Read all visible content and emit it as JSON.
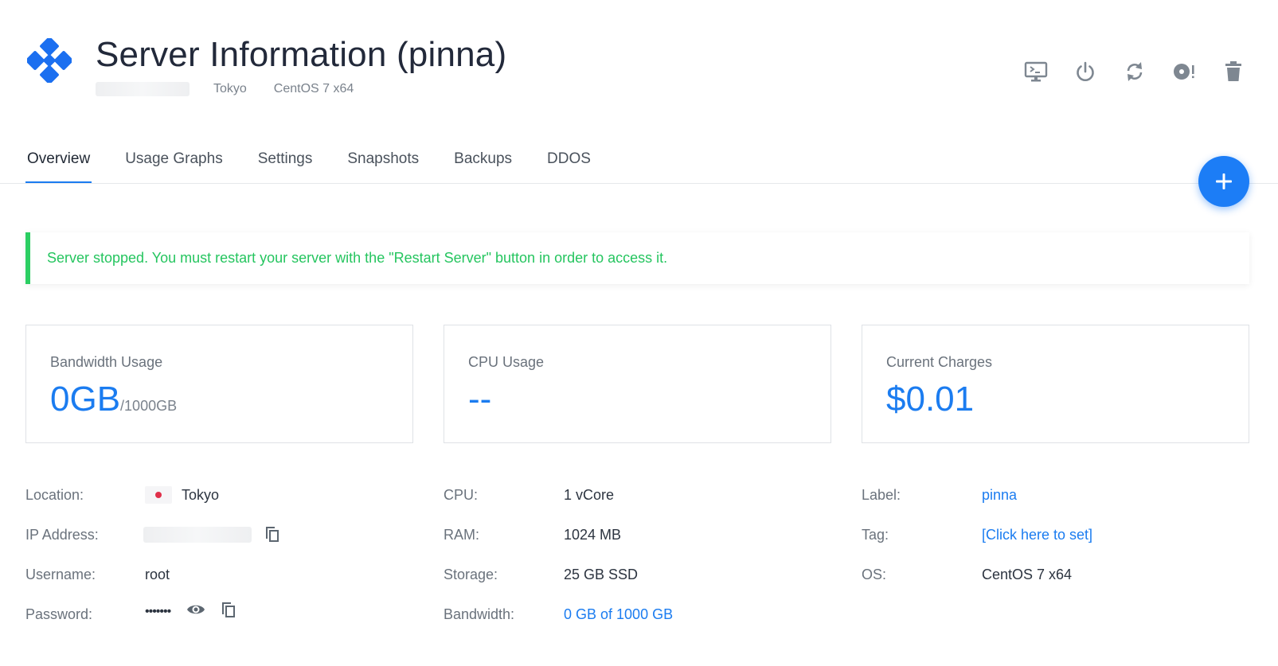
{
  "header": {
    "title": "Server Information (pinna)",
    "location": "Tokyo",
    "os": "CentOS 7 x64",
    "logo_icon": "vultr-logo-icon",
    "accent_color": "#1b7cf0"
  },
  "toolbar": {
    "buttons": [
      {
        "name": "console-icon"
      },
      {
        "name": "power-icon"
      },
      {
        "name": "restart-icon"
      },
      {
        "name": "reinstall-icon"
      },
      {
        "name": "trash-icon"
      }
    ]
  },
  "tabs": [
    {
      "label": "Overview",
      "active": true
    },
    {
      "label": "Usage Graphs",
      "active": false
    },
    {
      "label": "Settings",
      "active": false
    },
    {
      "label": "Snapshots",
      "active": false
    },
    {
      "label": "Backups",
      "active": false
    },
    {
      "label": "DDOS",
      "active": false
    }
  ],
  "fab": {
    "icon": "plus-icon"
  },
  "alert": {
    "message": "Server stopped. You must restart your server with the \"Restart Server\" button in order to access it.",
    "color": "#25c55f"
  },
  "cards": [
    {
      "label": "Bandwidth Usage",
      "value": "0GB",
      "suffix": "/1000GB"
    },
    {
      "label": "CPU Usage",
      "value": "--",
      "suffix": ""
    },
    {
      "label": "Current Charges",
      "value": "$0.01",
      "suffix": ""
    }
  ],
  "details": {
    "location_label": "Location:",
    "location_value": "Tokyo",
    "ip_label": "IP Address:",
    "username_label": "Username:",
    "username_value": "root",
    "password_label": "Password:",
    "password_value": "•••••••",
    "cpu_label": "CPU:",
    "cpu_value": "1 vCore",
    "ram_label": "RAM:",
    "ram_value": "1024 MB",
    "storage_label": "Storage:",
    "storage_value": "25 GB SSD",
    "bandwidth_label": "Bandwidth:",
    "bandwidth_value": "0 GB of 1000 GB",
    "label_label": "Label:",
    "label_value": "pinna",
    "tag_label": "Tag:",
    "tag_value": "[Click here to set]",
    "os_label": "OS:",
    "os_value": "CentOS 7 x64"
  }
}
